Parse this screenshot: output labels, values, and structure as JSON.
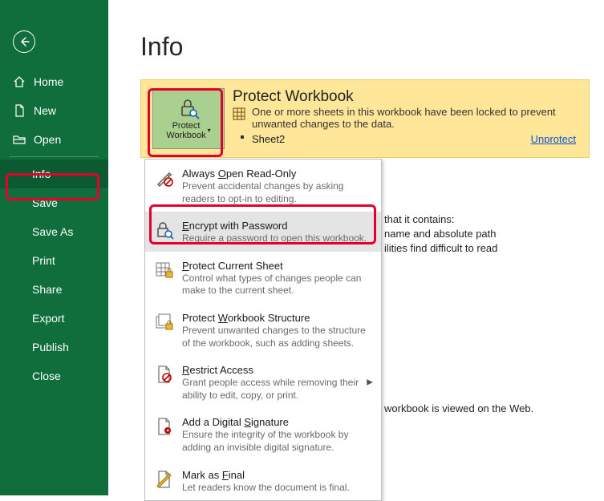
{
  "page": {
    "title": "Info"
  },
  "sidebar": {
    "items": [
      {
        "label": "Home"
      },
      {
        "label": "New"
      },
      {
        "label": "Open"
      },
      {
        "label": "Info"
      },
      {
        "label": "Save"
      },
      {
        "label": "Save As"
      },
      {
        "label": "Print"
      },
      {
        "label": "Share"
      },
      {
        "label": "Export"
      },
      {
        "label": "Publish"
      },
      {
        "label": "Close"
      }
    ]
  },
  "protect": {
    "button_label_line1": "Protect",
    "button_label_line2": "Workbook",
    "title": "Protect Workbook",
    "desc": "One or more sheets in this workbook have been locked to prevent unwanted changes to the data.",
    "sheet": "Sheet2",
    "unprotect": "Unprotect"
  },
  "bg": {
    "line1": "that it contains:",
    "line2": "name and absolute path",
    "line3": "ilities find difficult to read",
    "line4": "workbook is viewed on the Web."
  },
  "dropdown": {
    "items": [
      {
        "title": "Always Open Read-Only",
        "mnem": "O",
        "desc": "Prevent accidental changes by asking readers to opt-in to editing."
      },
      {
        "title": "Encrypt with Password",
        "mnem": "E",
        "desc": "Require a password to open this workbook."
      },
      {
        "title": "Protect Current Sheet",
        "mnem": "P",
        "desc": "Control what types of changes people can make to the current sheet."
      },
      {
        "title": "Protect Workbook Structure",
        "mnem": "W",
        "desc": "Prevent unwanted changes to the structure of the workbook, such as adding sheets."
      },
      {
        "title": "Restrict Access",
        "mnem": "R",
        "desc": "Grant people access while removing their ability to edit, copy, or print.",
        "submenu": true
      },
      {
        "title": "Add a Digital Signature",
        "mnem": "S",
        "desc": "Ensure the integrity of the workbook by adding an invisible digital signature."
      },
      {
        "title": "Mark as Final",
        "mnem": "F",
        "desc": "Let readers know the document is final."
      }
    ]
  }
}
